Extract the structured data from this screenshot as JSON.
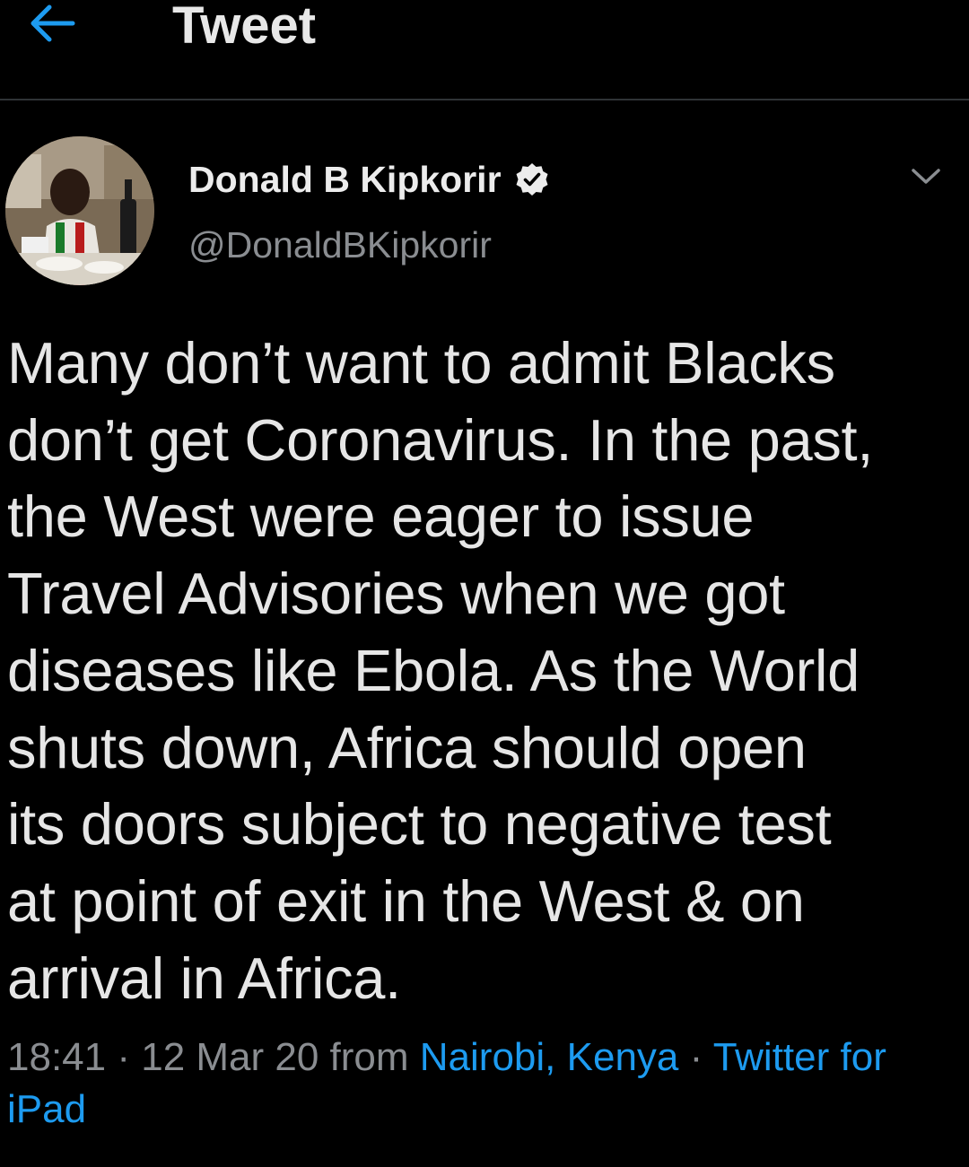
{
  "header": {
    "back_icon": "arrow-left-icon",
    "title": "Tweet"
  },
  "colors": {
    "background": "#000000",
    "accent": "#1d9bf0",
    "text_primary": "#e6e6e6",
    "text_secondary": "#8a8d91",
    "divider": "#2f3336"
  },
  "author": {
    "display_name": "Donald B Kipkorir",
    "verified_icon": "verified-badge-icon",
    "handle": "@DonaldBKipkorir",
    "menu_icon": "chevron-down-icon"
  },
  "tweet": {
    "text": "Many don’t want to admit Blacks\ndon’t get Coronavirus. In the past,\nthe West were eager to issue\nTravel Advisories when we got\ndiseases like Ebola. As the World\nshuts down, Africa should open\nits doors subject to negative test\nat point of exit in the West & on\narrival in Africa."
  },
  "meta": {
    "time": "18:41",
    "separator": " · ",
    "date": "12 Mar 20",
    "from_label": " from ",
    "location": "Nairobi, Kenya",
    "source": "Twitter for iPad"
  }
}
